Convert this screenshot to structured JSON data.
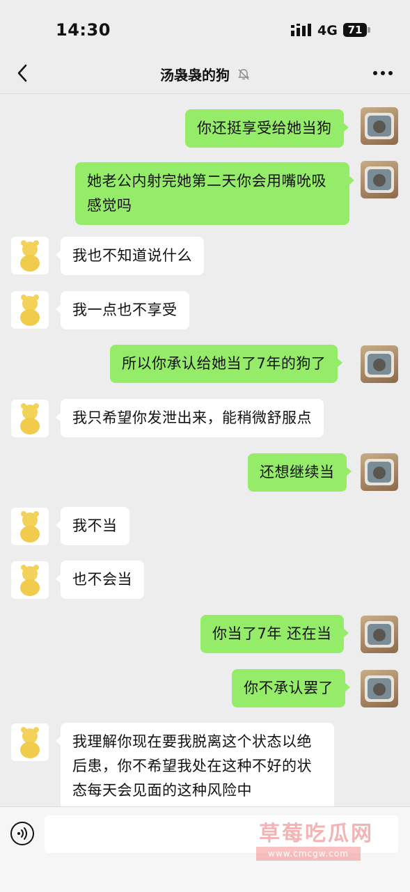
{
  "status_bar": {
    "time": "14:30",
    "network": "4G",
    "battery": "71"
  },
  "header": {
    "title": "汤袅袅的狗"
  },
  "messages": [
    {
      "side": "self",
      "text": "你还挺享受给她当狗"
    },
    {
      "side": "self",
      "text": "她老公内射完她第二天你会用嘴吮吸感觉吗"
    },
    {
      "side": "other",
      "text": "我也不知道说什么"
    },
    {
      "side": "other",
      "text": "我一点也不享受"
    },
    {
      "side": "self",
      "text": "所以你承认给她当了7年的狗了"
    },
    {
      "side": "other",
      "text": "我只希望你发泄出来，能稍微舒服点"
    },
    {
      "side": "self",
      "text": "还想继续当"
    },
    {
      "side": "other",
      "text": "我不当"
    },
    {
      "side": "other",
      "text": "也不会当"
    },
    {
      "side": "self",
      "text": "你当了7年 还在当"
    },
    {
      "side": "self",
      "text": "你不承认罢了"
    },
    {
      "side": "other",
      "text": "我理解你现在要我脱离这个状态以绝后患，你不希望我处在这种不好的状态每天会见面的这种风险中"
    }
  ],
  "watermark": {
    "title": "草莓吃瓜网",
    "url": "www.cmcgw.com"
  },
  "colors": {
    "self_bubble": "#95ec69",
    "other_bubble": "#ffffff",
    "background": "#ededed"
  }
}
